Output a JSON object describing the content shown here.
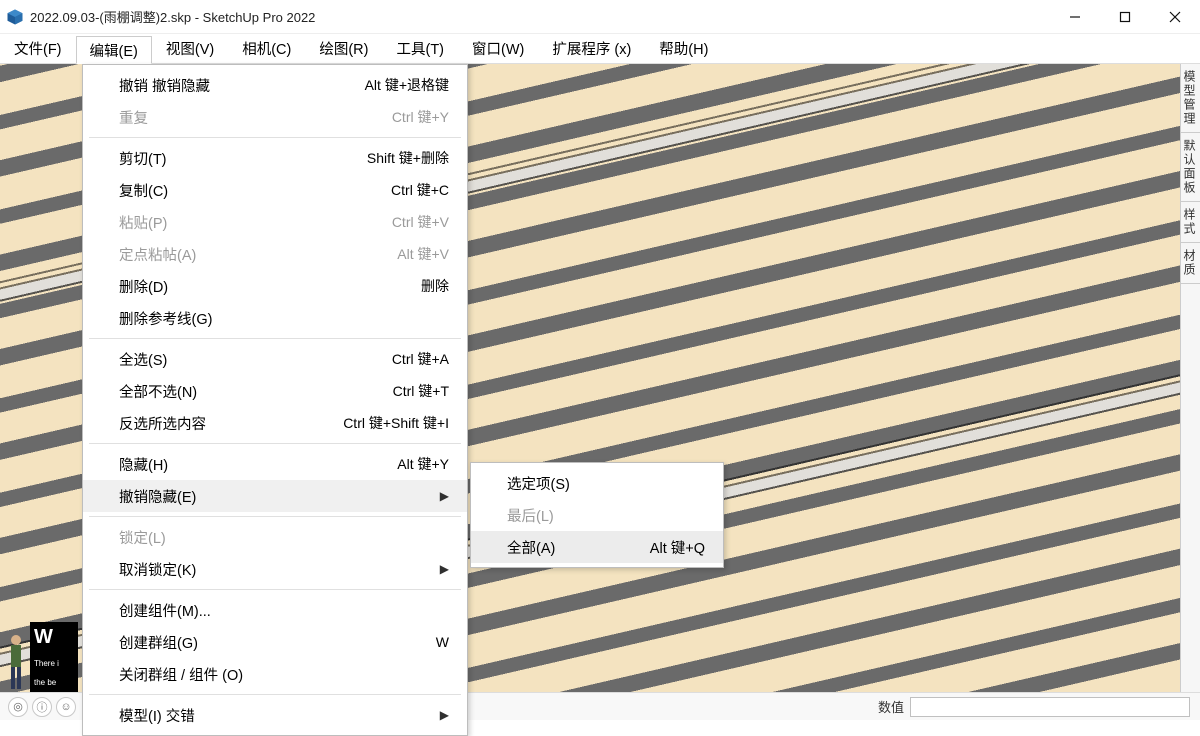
{
  "title": "2022.09.03-(雨棚调整)2.skp - SketchUp Pro 2022",
  "menubar": [
    "文件(F)",
    "编辑(E)",
    "视图(V)",
    "相机(C)",
    "绘图(R)",
    "工具(T)",
    "窗口(W)",
    "扩展程序 (x)",
    "帮助(H)"
  ],
  "active_menu_index": 1,
  "edit_menu": [
    {
      "label": "撤销 撤销隐藏",
      "shortcut": "Alt 键+退格键"
    },
    {
      "label": "重复",
      "shortcut": "Ctrl 键+Y",
      "disabled": true
    },
    {
      "sep": true
    },
    {
      "label": "剪切(T)",
      "shortcut": "Shift 键+删除"
    },
    {
      "label": "复制(C)",
      "shortcut": "Ctrl 键+C"
    },
    {
      "label": "粘贴(P)",
      "shortcut": "Ctrl 键+V",
      "disabled": true
    },
    {
      "label": "定点粘帖(A)",
      "shortcut": "Alt 键+V",
      "disabled": true
    },
    {
      "label": "删除(D)",
      "shortcut": "删除"
    },
    {
      "label": "删除参考线(G)"
    },
    {
      "sep": true
    },
    {
      "label": "全选(S)",
      "shortcut": "Ctrl 键+A"
    },
    {
      "label": "全部不选(N)",
      "shortcut": "Ctrl 键+T"
    },
    {
      "label": "反选所选内容",
      "shortcut": "Ctrl 键+Shift 键+I"
    },
    {
      "sep": true
    },
    {
      "label": "隐藏(H)",
      "shortcut": "Alt 键+Y"
    },
    {
      "label": "撤销隐藏(E)",
      "submenu": true,
      "highlight": true
    },
    {
      "sep": true
    },
    {
      "label": "锁定(L)",
      "disabled": true
    },
    {
      "label": "取消锁定(K)",
      "submenu": true
    },
    {
      "sep": true
    },
    {
      "label": "创建组件(M)..."
    },
    {
      "label": "创建群组(G)",
      "shortcut": "W"
    },
    {
      "label": "关闭群组 / 组件 (O)"
    },
    {
      "sep": true
    },
    {
      "label": "模型(I) 交错",
      "submenu": true
    }
  ],
  "unhide_submenu": [
    {
      "label": "选定项(S)"
    },
    {
      "label": "最后(L)",
      "disabled": true
    },
    {
      "label": "全部(A)",
      "shortcut": "Alt 键+Q",
      "highlight": true
    }
  ],
  "tray_tabs": [
    "模型管理",
    "默认面板",
    "样式",
    "材质"
  ],
  "status": {
    "measure_label": "数值"
  },
  "thumb": {
    "big": "W",
    "small1": "There i",
    "small2": "the be"
  }
}
